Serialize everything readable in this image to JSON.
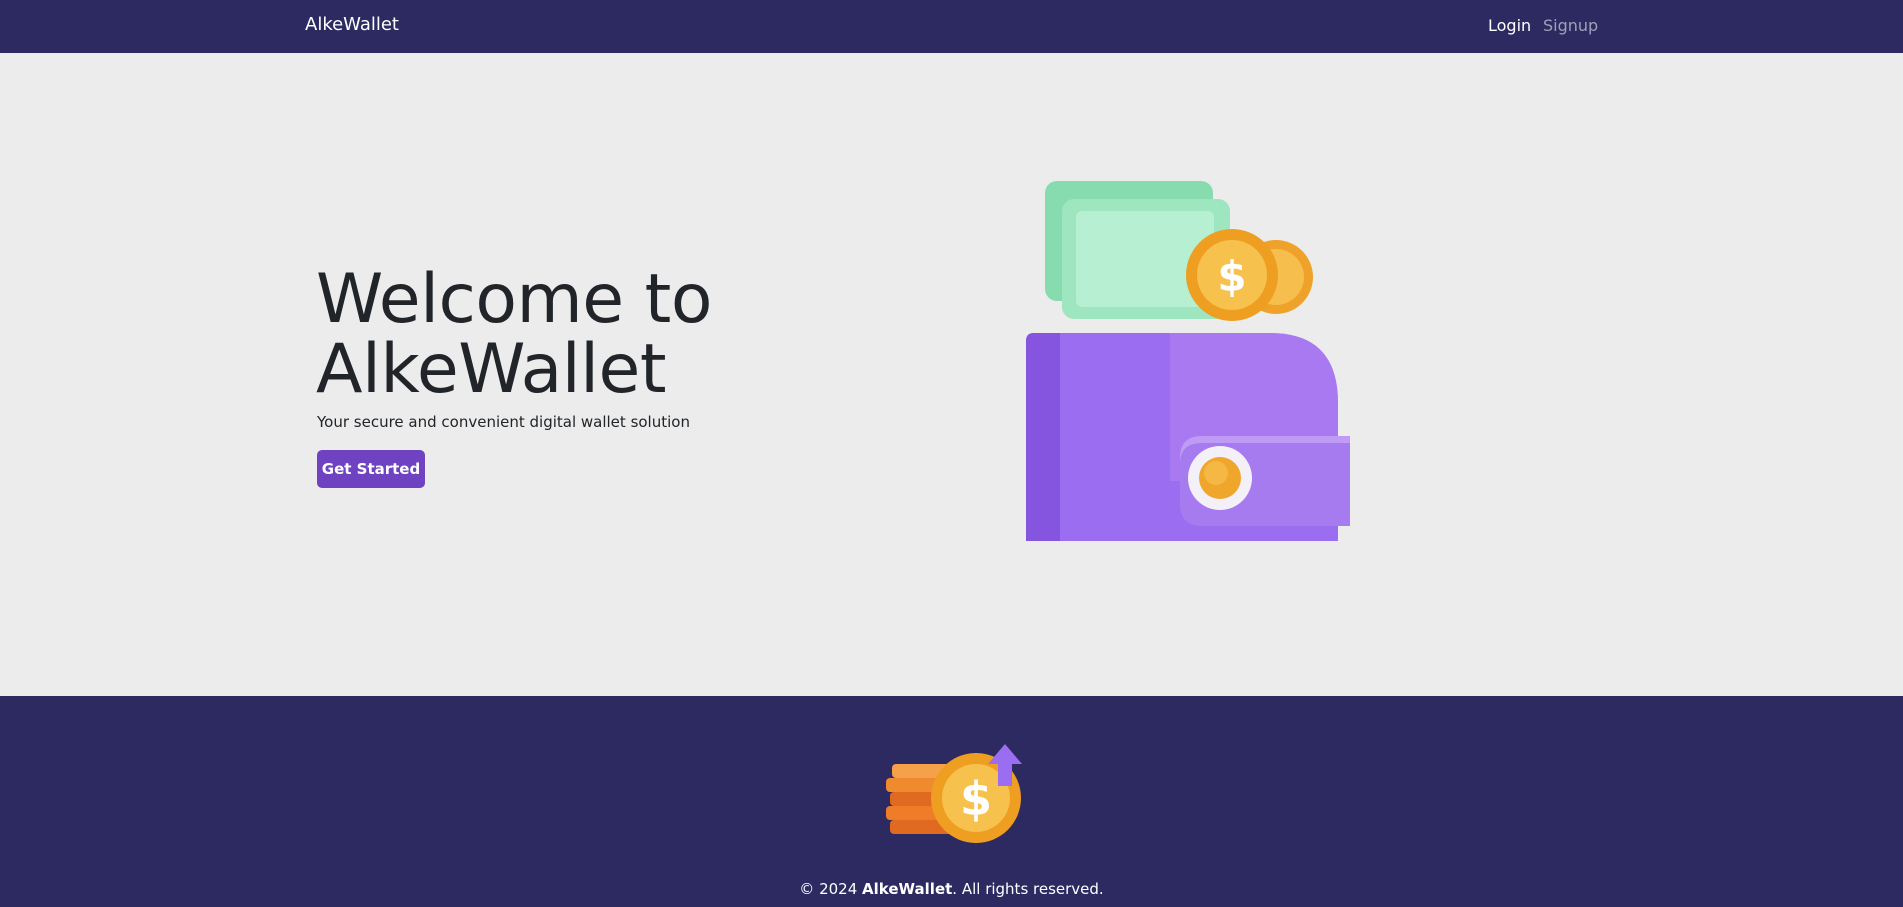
{
  "navbar": {
    "brand": "AlkeWallet",
    "links": [
      {
        "label": "Login",
        "active": true
      },
      {
        "label": "Signup",
        "active": false
      }
    ]
  },
  "hero": {
    "title_line1": "Welcome to",
    "title_line2": "AlkeWallet",
    "subtitle": "Your secure and convenient digital wallet solution",
    "cta_label": "Get Started",
    "illustration_icon": "wallet-with-money-icon"
  },
  "footer": {
    "illustration_icon": "coins-growth-icon",
    "copyright_prefix": "© 2024",
    "copyright_brand": "AlkeWallet",
    "copyright_suffix": ". All rights reserved."
  },
  "colors": {
    "navbar_bg": "#2c2a61",
    "hero_bg": "#ececec",
    "accent": "#6f42c1",
    "wallet": "#9b6df0",
    "bill": "#8fe0b8",
    "coin": "#f2b136"
  }
}
